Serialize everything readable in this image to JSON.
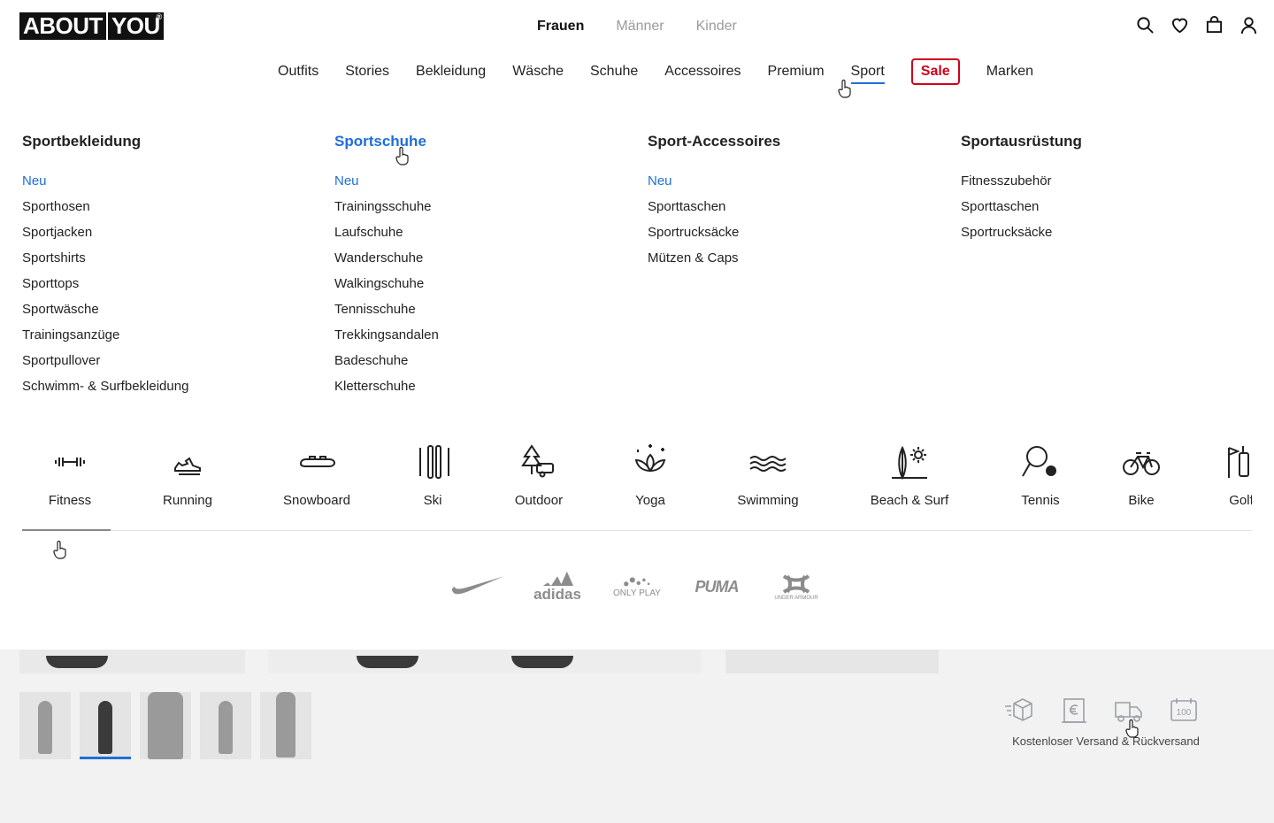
{
  "header": {
    "logo_left": "ABOUT",
    "logo_right": "YOU",
    "logo_mark": "®",
    "gender_tabs": [
      {
        "label": "Frauen",
        "active": true
      },
      {
        "label": "Männer",
        "active": false
      },
      {
        "label": "Kinder",
        "active": false
      }
    ],
    "icons": [
      "search-icon",
      "heart-icon",
      "bag-icon",
      "user-icon"
    ]
  },
  "nav": {
    "items": [
      "Outfits",
      "Stories",
      "Bekleidung",
      "Wäsche",
      "Schuhe",
      "Accessoires",
      "Premium",
      "Sport",
      "Sale",
      "Marken"
    ],
    "active": "Sport",
    "sale_color": "#d0021b",
    "accent_color": "#1e6fd9"
  },
  "menu": {
    "columns": [
      {
        "title": "Sportbekleidung",
        "items": [
          "Neu",
          "Sporthosen",
          "Sportjacken",
          "Sportshirts",
          "Sporttops",
          "Sportwäsche",
          "Trainingsanzüge",
          "Sportpullover",
          "Schwimm- & Surfbekleidung"
        ]
      },
      {
        "title": "Sportschuhe",
        "items": [
          "Neu",
          "Trainingsschuhe",
          "Laufschuhe",
          "Wanderschuhe",
          "Walkingschuhe",
          "Tennisschuhe",
          "Trekkingsandalen",
          "Badeschuhe",
          "Kletterschuhe"
        ]
      },
      {
        "title": "Sport-Accessoires",
        "items": [
          "Neu",
          "Sporttaschen",
          "Sportrucksäcke",
          "Mützen & Caps"
        ]
      },
      {
        "title": "Sportausrüstung",
        "items": [
          "Fitnesszubehör",
          "Sporttaschen",
          "Sportrucksäcke"
        ]
      }
    ]
  },
  "sports": {
    "items": [
      {
        "label": "Fitness",
        "icon": "dumbbell-icon"
      },
      {
        "label": "Running",
        "icon": "running-shoe-icon"
      },
      {
        "label": "Snowboard",
        "icon": "snowboard-icon"
      },
      {
        "label": "Ski",
        "icon": "ski-icon"
      },
      {
        "label": "Outdoor",
        "icon": "outdoor-icon"
      },
      {
        "label": "Yoga",
        "icon": "lotus-icon"
      },
      {
        "label": "Swimming",
        "icon": "waves-icon"
      },
      {
        "label": "Beach & Surf",
        "icon": "surfboard-icon"
      },
      {
        "label": "Tennis",
        "icon": "tennis-racket-icon"
      },
      {
        "label": "Bike",
        "icon": "bicycle-icon"
      },
      {
        "label": "Golf",
        "icon": "golf-icon"
      }
    ]
  },
  "brands": [
    {
      "name": "nike",
      "icon": "nike-swoosh-icon"
    },
    {
      "name": "adidas",
      "label": "adidas"
    },
    {
      "name": "onlyplay",
      "label": "ONLY PLAY"
    },
    {
      "name": "puma",
      "label": "PUMA"
    },
    {
      "name": "under-armour",
      "label": "UNDER ARMOUR"
    }
  ],
  "service": {
    "text": "Kostenloser Versand & Rückversand",
    "icons": [
      "fast-delivery-box-icon",
      "invoice-euro-icon",
      "return-truck-icon",
      "100-days-calendar-icon"
    ]
  }
}
